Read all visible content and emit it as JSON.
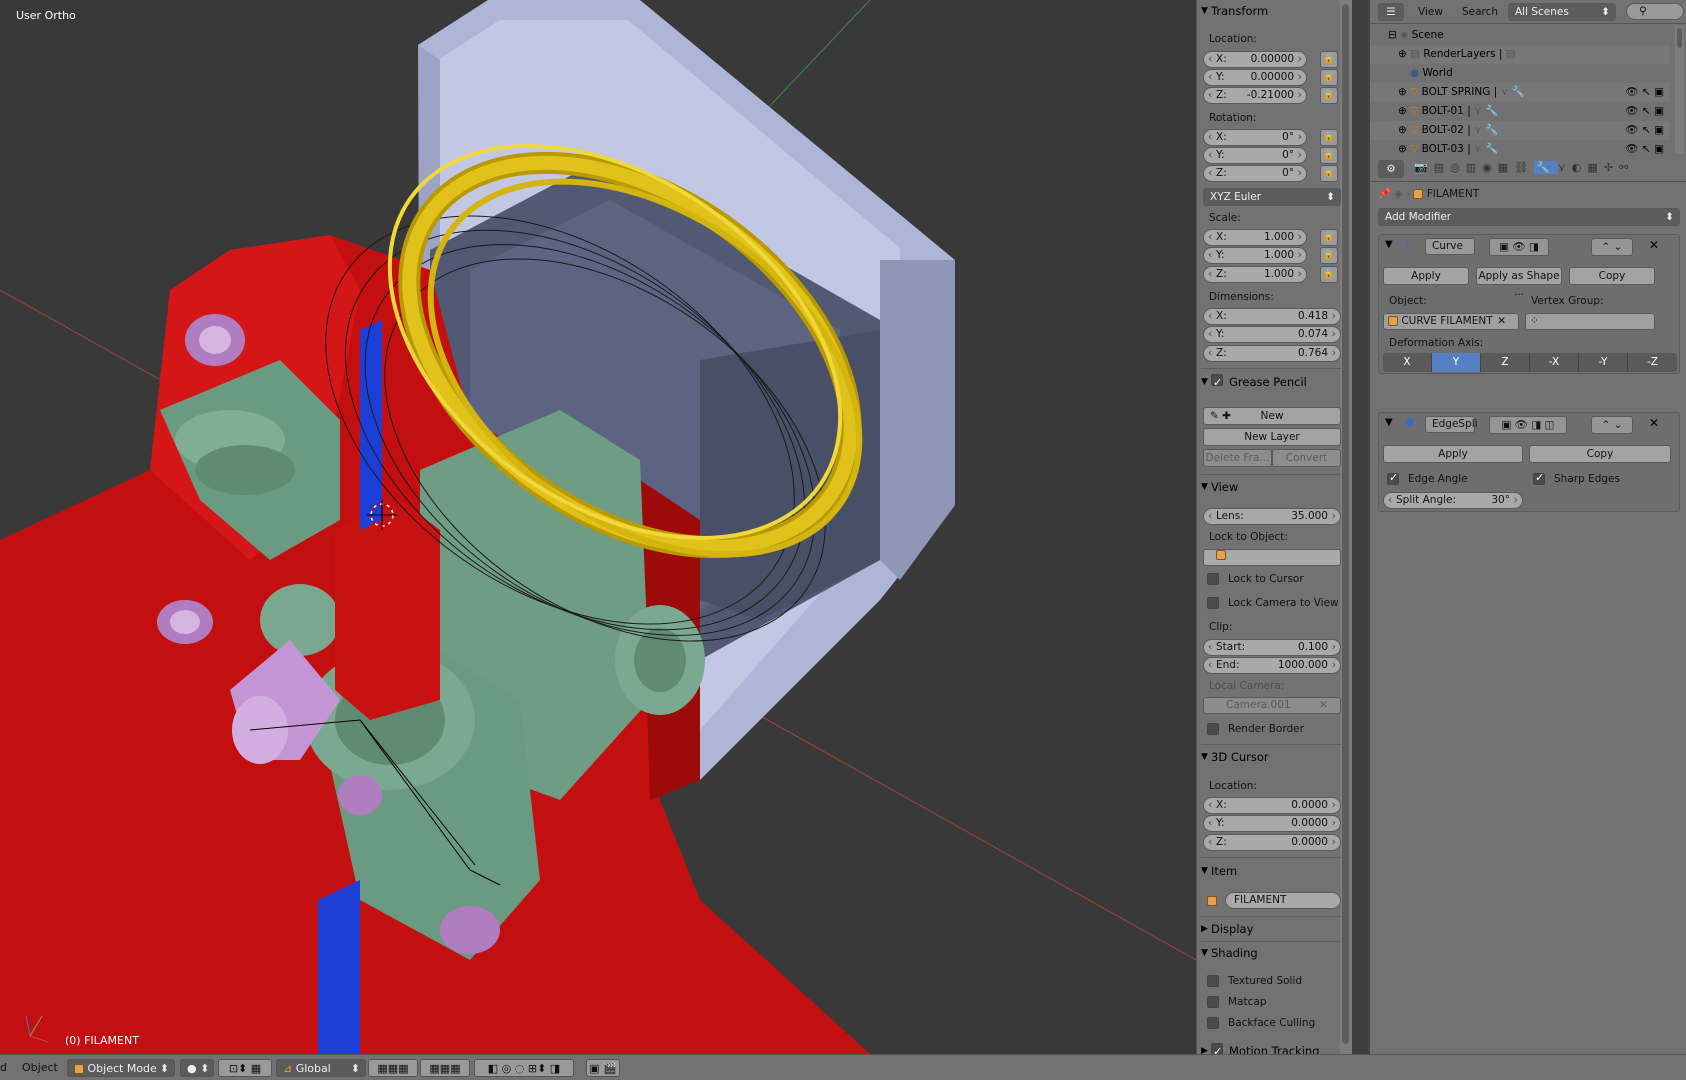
{
  "viewport": {
    "view_label": "User Ortho",
    "object_label": "(0) FILAMENT"
  },
  "npanel": {
    "transform": {
      "title": "Transform",
      "location_label": "Location:",
      "location": [
        {
          "axis": "X:",
          "value": "0.00000"
        },
        {
          "axis": "Y:",
          "value": "0.00000"
        },
        {
          "axis": "Z:",
          "value": "-0.21000"
        }
      ],
      "rotation_label": "Rotation:",
      "rotation": [
        {
          "axis": "X:",
          "value": "0°"
        },
        {
          "axis": "Y:",
          "value": "0°"
        },
        {
          "axis": "Z:",
          "value": "0°"
        }
      ],
      "rotation_mode": "XYZ Euler",
      "scale_label": "Scale:",
      "scale": [
        {
          "axis": "X:",
          "value": "1.000"
        },
        {
          "axis": "Y:",
          "value": "1.000"
        },
        {
          "axis": "Z:",
          "value": "1.000"
        }
      ],
      "dimensions_label": "Dimensions:",
      "dimensions": [
        {
          "axis": "X:",
          "value": "0.418"
        },
        {
          "axis": "Y:",
          "value": "0.074"
        },
        {
          "axis": "Z:",
          "value": "0.764"
        }
      ]
    },
    "grease_pencil": {
      "title": "Grease Pencil",
      "new_label": "New",
      "new_layer_label": "New Layer",
      "delete_frame_label": "Delete Fra...",
      "convert_label": "Convert"
    },
    "view": {
      "title": "View",
      "lens_label": "Lens:",
      "lens_value": "35.000",
      "lock_to_object_label": "Lock to Object:",
      "lock_to_cursor_label": "Lock to Cursor",
      "lock_camera_label": "Lock Camera to View",
      "clip_label": "Clip:",
      "clip_start_label": "Start:",
      "clip_start_value": "0.100",
      "clip_end_label": "End:",
      "clip_end_value": "1000.000",
      "local_camera_label": "Local Camera:",
      "local_camera_value": "Camera.001",
      "render_border_label": "Render Border"
    },
    "cursor": {
      "title": "3D Cursor",
      "location_label": "Location:",
      "location": [
        {
          "axis": "X:",
          "value": "0.0000"
        },
        {
          "axis": "Y:",
          "value": "0.0000"
        },
        {
          "axis": "Z:",
          "value": "0.0000"
        }
      ]
    },
    "item": {
      "title": "Item",
      "name": "FILAMENT"
    },
    "display": {
      "title": "Display"
    },
    "shading": {
      "title": "Shading",
      "textured_solid": "Textured Solid",
      "matcap": "Matcap",
      "backface_culling": "Backface Culling"
    },
    "motion_tracking": {
      "title": "Motion Tracking"
    }
  },
  "outliner": {
    "view_menu": "View",
    "search_menu": "Search",
    "scenes_dropdown": "All Scenes",
    "rows": [
      {
        "label": "Scene"
      },
      {
        "label": "RenderLayers"
      },
      {
        "label": "World"
      },
      {
        "label": "BOLT SPRING"
      },
      {
        "label": "BOLT-01"
      },
      {
        "label": "BOLT-02"
      },
      {
        "label": "BOLT-03"
      }
    ]
  },
  "properties": {
    "context_object": "FILAMENT",
    "add_modifier_label": "Add Modifier",
    "curve_modifier": {
      "name": "Curve",
      "apply_label": "Apply",
      "apply_shape_label": "Apply as Shape ...",
      "copy_label": "Copy",
      "object_label": "Object:",
      "object_value": "CURVE FILAMENT",
      "vertex_group_label": "Vertex Group:",
      "deformation_axis_label": "Deformation Axis:",
      "axes": [
        "X",
        "Y",
        "Z",
        "-X",
        "-Y",
        "-Z"
      ],
      "active_axis": "Y"
    },
    "edgesplit_modifier": {
      "name": "EdgeSpli",
      "apply_label": "Apply",
      "copy_label": "Copy",
      "edge_angle_label": "Edge Angle",
      "sharp_edges_label": "Sharp Edges",
      "split_angle_label": "Split Angle:",
      "split_angle_value": "30°"
    }
  },
  "footer": {
    "view_menu": "d",
    "object_menu": "Object",
    "mode": "Object Mode",
    "orientation": "Global"
  }
}
